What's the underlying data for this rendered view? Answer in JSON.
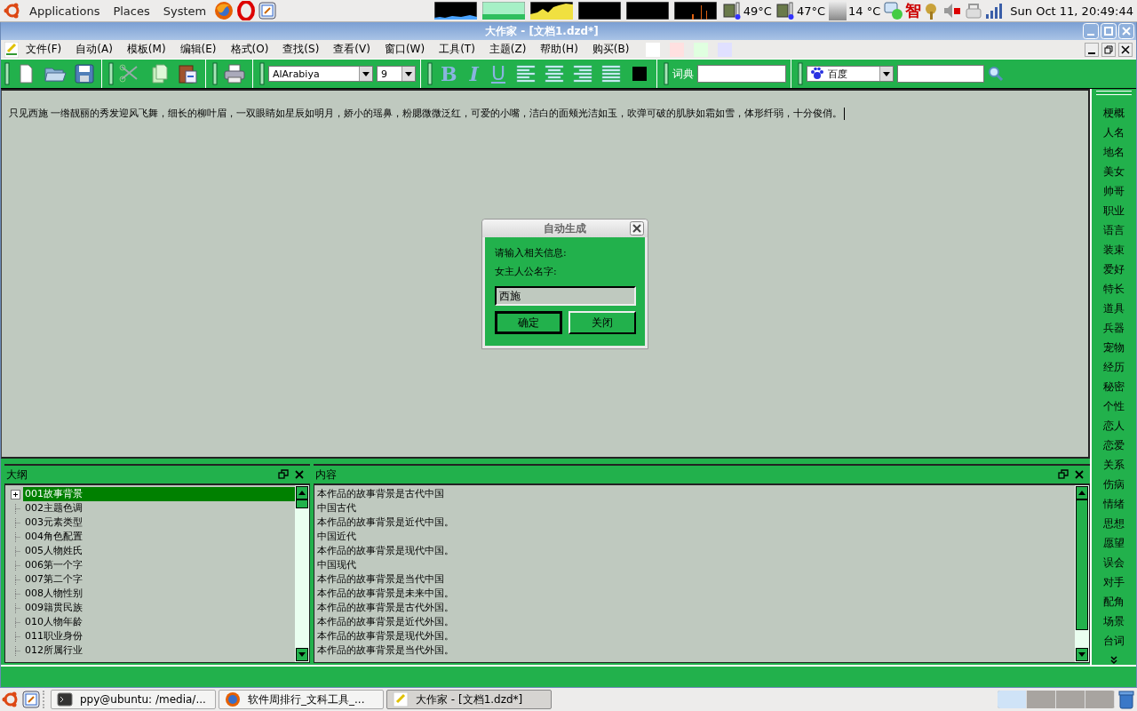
{
  "top_panel": {
    "menus": [
      "Applications",
      "Places",
      "System"
    ],
    "sensors": [
      {
        "reading": "49°C"
      },
      {
        "reading": "47°C"
      },
      {
        "reading": "14 °C"
      }
    ],
    "tray_glyph": "智",
    "clock": "Sun Oct 11, 20:49:44"
  },
  "window": {
    "title": "大作家 - [文档1.dzd*]"
  },
  "menu_bar": [
    "文件(F)",
    "自动(A)",
    "模板(M)",
    "编辑(E)",
    "格式(O)",
    "查找(S)",
    "查看(V)",
    "窗口(W)",
    "工具(T)",
    "主题(Z)",
    "帮助(H)",
    "购买(B)"
  ],
  "theme_swatches": [
    {
      "color": "#ffffff"
    },
    {
      "color": "#ffe0e0"
    },
    {
      "color": "#e0ffe0"
    },
    {
      "color": "#e0e0ff"
    }
  ],
  "toolbar": {
    "font": "AlArabiya",
    "size": "9",
    "format_buttons": [
      "B",
      "I",
      "U"
    ],
    "text_color": {
      "color": "#000000"
    },
    "dictionary_label": "词典",
    "search_engine": "百度"
  },
  "editor": {
    "text": "只见西施 一绺靓丽的秀发迎风飞舞，细长的柳叶眉，一双眼睛如星辰如明月，娇小的瑶鼻，粉腮微微泛红，可爱的小嘴，洁白的面颊光洁如玉，吹弹可破的肌肤如霜如雪，体形纤弱，十分俊俏。"
  },
  "dialog": {
    "title": "自动生成",
    "prompt": "请输入相关信息:",
    "field_label": "女主人公名字:",
    "value": "西施",
    "buttons": [
      {
        "label": "确定",
        "default": true
      },
      {
        "label": "关闭",
        "default": false
      }
    ]
  },
  "outline": {
    "title": "大纲",
    "items": [
      {
        "label": "001故事背景",
        "selected": true,
        "expandable": true
      },
      {
        "label": "002主题色调",
        "selected": false,
        "expandable": false
      },
      {
        "label": "003元素类型",
        "selected": false,
        "expandable": false
      },
      {
        "label": "004角色配置",
        "selected": false,
        "expandable": false
      },
      {
        "label": "005人物姓氏",
        "selected": false,
        "expandable": false
      },
      {
        "label": "006第一个字",
        "selected": false,
        "expandable": false
      },
      {
        "label": "007第二个字",
        "selected": false,
        "expandable": false
      },
      {
        "label": "008人物性别",
        "selected": false,
        "expandable": false
      },
      {
        "label": "009籍贯民族",
        "selected": false,
        "expandable": false
      },
      {
        "label": "010人物年龄",
        "selected": false,
        "expandable": false
      },
      {
        "label": "011职业身份",
        "selected": false,
        "expandable": false
      },
      {
        "label": "012所属行业",
        "selected": false,
        "expandable": false
      }
    ]
  },
  "content": {
    "title": "内容",
    "lines": [
      "本作品的故事背景是古代中国",
      "中国古代",
      "本作品的故事背景是近代中国。",
      "中国近代",
      "本作品的故事背景是现代中国。",
      "中国现代",
      "本作品的故事背景是当代中国",
      "本作品的故事背景是未来中国。",
      "本作品的故事背景是古代外国。",
      "本作品的故事背景是近代外国。",
      "本作品的故事背景是现代外国。",
      "本作品的故事背景是当代外国。"
    ]
  },
  "sidebar": {
    "items": [
      "梗概",
      "人名",
      "地名",
      "美女",
      "帅哥",
      "职业",
      "语言",
      "装束",
      "爱好",
      "特长",
      "道具",
      "兵器",
      "宠物",
      "经历",
      "秘密",
      "个性",
      "恋人",
      "恋爱",
      "关系",
      "伤病",
      "情绪",
      "思想",
      "愿望",
      "误会",
      "对手",
      "配角",
      "场景",
      "台词"
    ]
  },
  "taskbar": {
    "tasks": [
      {
        "label": "ppy@ubuntu: /media/...",
        "kind": "terminal",
        "selected": false
      },
      {
        "label": "软件周排行_文科工具_...",
        "kind": "browser",
        "selected": false
      },
      {
        "label": "大作家 - [文档1.dzd*]",
        "kind": "app",
        "selected": true
      }
    ],
    "workspaces": [
      {
        "selected": true
      },
      {
        "selected": false
      },
      {
        "selected": false
      },
      {
        "selected": false
      }
    ]
  }
}
